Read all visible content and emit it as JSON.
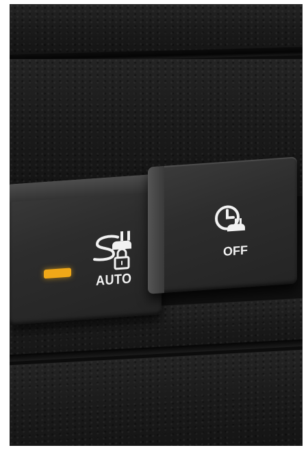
{
  "auto_charge_button": {
    "label": "AUTO",
    "icon": "plug-lock-icon",
    "indicator_color": "#f0a818"
  },
  "timer_off_button": {
    "label": "OFF",
    "icon": "clock-plug-icon"
  }
}
